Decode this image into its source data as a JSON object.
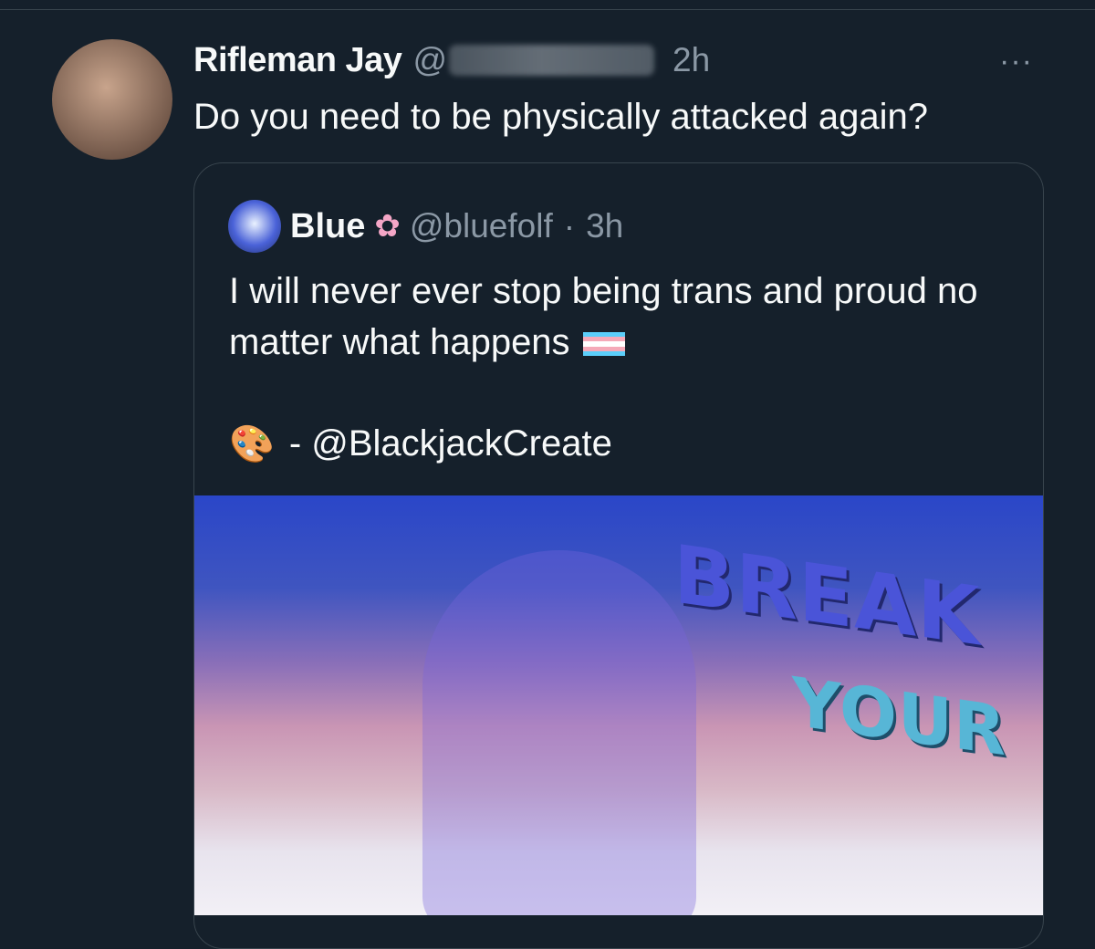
{
  "tweet": {
    "author_name": "Rifleman Jay",
    "handle_prefix": "@",
    "time": "2h",
    "more_label": "···",
    "text": "Do you need to be physically attacked again?"
  },
  "quoted": {
    "name": "Blue",
    "name_emoji": "flower-icon",
    "handle": "@bluefolf",
    "separator": "·",
    "time": "3h",
    "text": "I will never ever stop being trans and proud no matter what happens",
    "flag_icon": "transgender-flag-icon",
    "credit_icon": "palette-icon",
    "credit": "- @BlackjackCreate",
    "image_text_1": "BREAK",
    "image_text_2": "YOUR"
  },
  "colors": {
    "background": "#15202b",
    "text": "#f7f9f9",
    "secondary": "#8b98a5",
    "border": "#38444d"
  }
}
